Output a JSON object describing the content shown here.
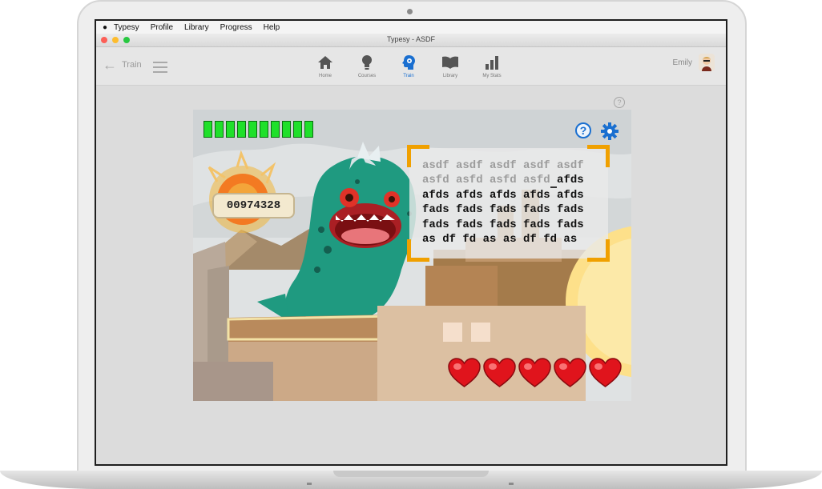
{
  "menubar": {
    "apple_icon": "apple-icon",
    "items": [
      "Typesy",
      "Profile",
      "Library",
      "Progress",
      "Help"
    ]
  },
  "window": {
    "title": "Typesy - ASDF",
    "traffic_lights": [
      "#fc5f57",
      "#fdbc2e",
      "#28c840"
    ]
  },
  "nav": {
    "back_label": "Train",
    "tabs": [
      {
        "label": "Home",
        "icon": "home-icon",
        "active": false
      },
      {
        "label": "Courses",
        "icon": "lightbulb-icon",
        "active": false
      },
      {
        "label": "Train",
        "icon": "brain-gear-icon",
        "active": true
      },
      {
        "label": "Library",
        "icon": "book-icon",
        "active": false
      },
      {
        "label": "My Stats",
        "icon": "bar-chart-icon",
        "active": false
      }
    ],
    "user_name": "Emily"
  },
  "help_icon_label": "?",
  "game": {
    "energy_segments": 10,
    "energy_color": "#1fe02a",
    "score": "00974328",
    "help_label": "?",
    "lives": 5,
    "heart_color": "#e0141c",
    "accent": "#1a6fd0",
    "bracket_color": "#f0a000",
    "lines": [
      {
        "typed": "asdf asdf asdf asdf asdf",
        "current": "",
        "rest": ""
      },
      {
        "typed": "asfd asfd asfd asfd",
        "current": " ",
        "rest": "afds"
      },
      {
        "typed": "",
        "current": "",
        "rest": "afds afds afds afds afds"
      },
      {
        "typed": "",
        "current": "",
        "rest": "fads fads fads fads fads"
      },
      {
        "typed": "",
        "current": "",
        "rest": "fads fads fads fads fads"
      },
      {
        "typed": "",
        "current": "",
        "rest": "as df fd as as df fd as"
      }
    ]
  }
}
